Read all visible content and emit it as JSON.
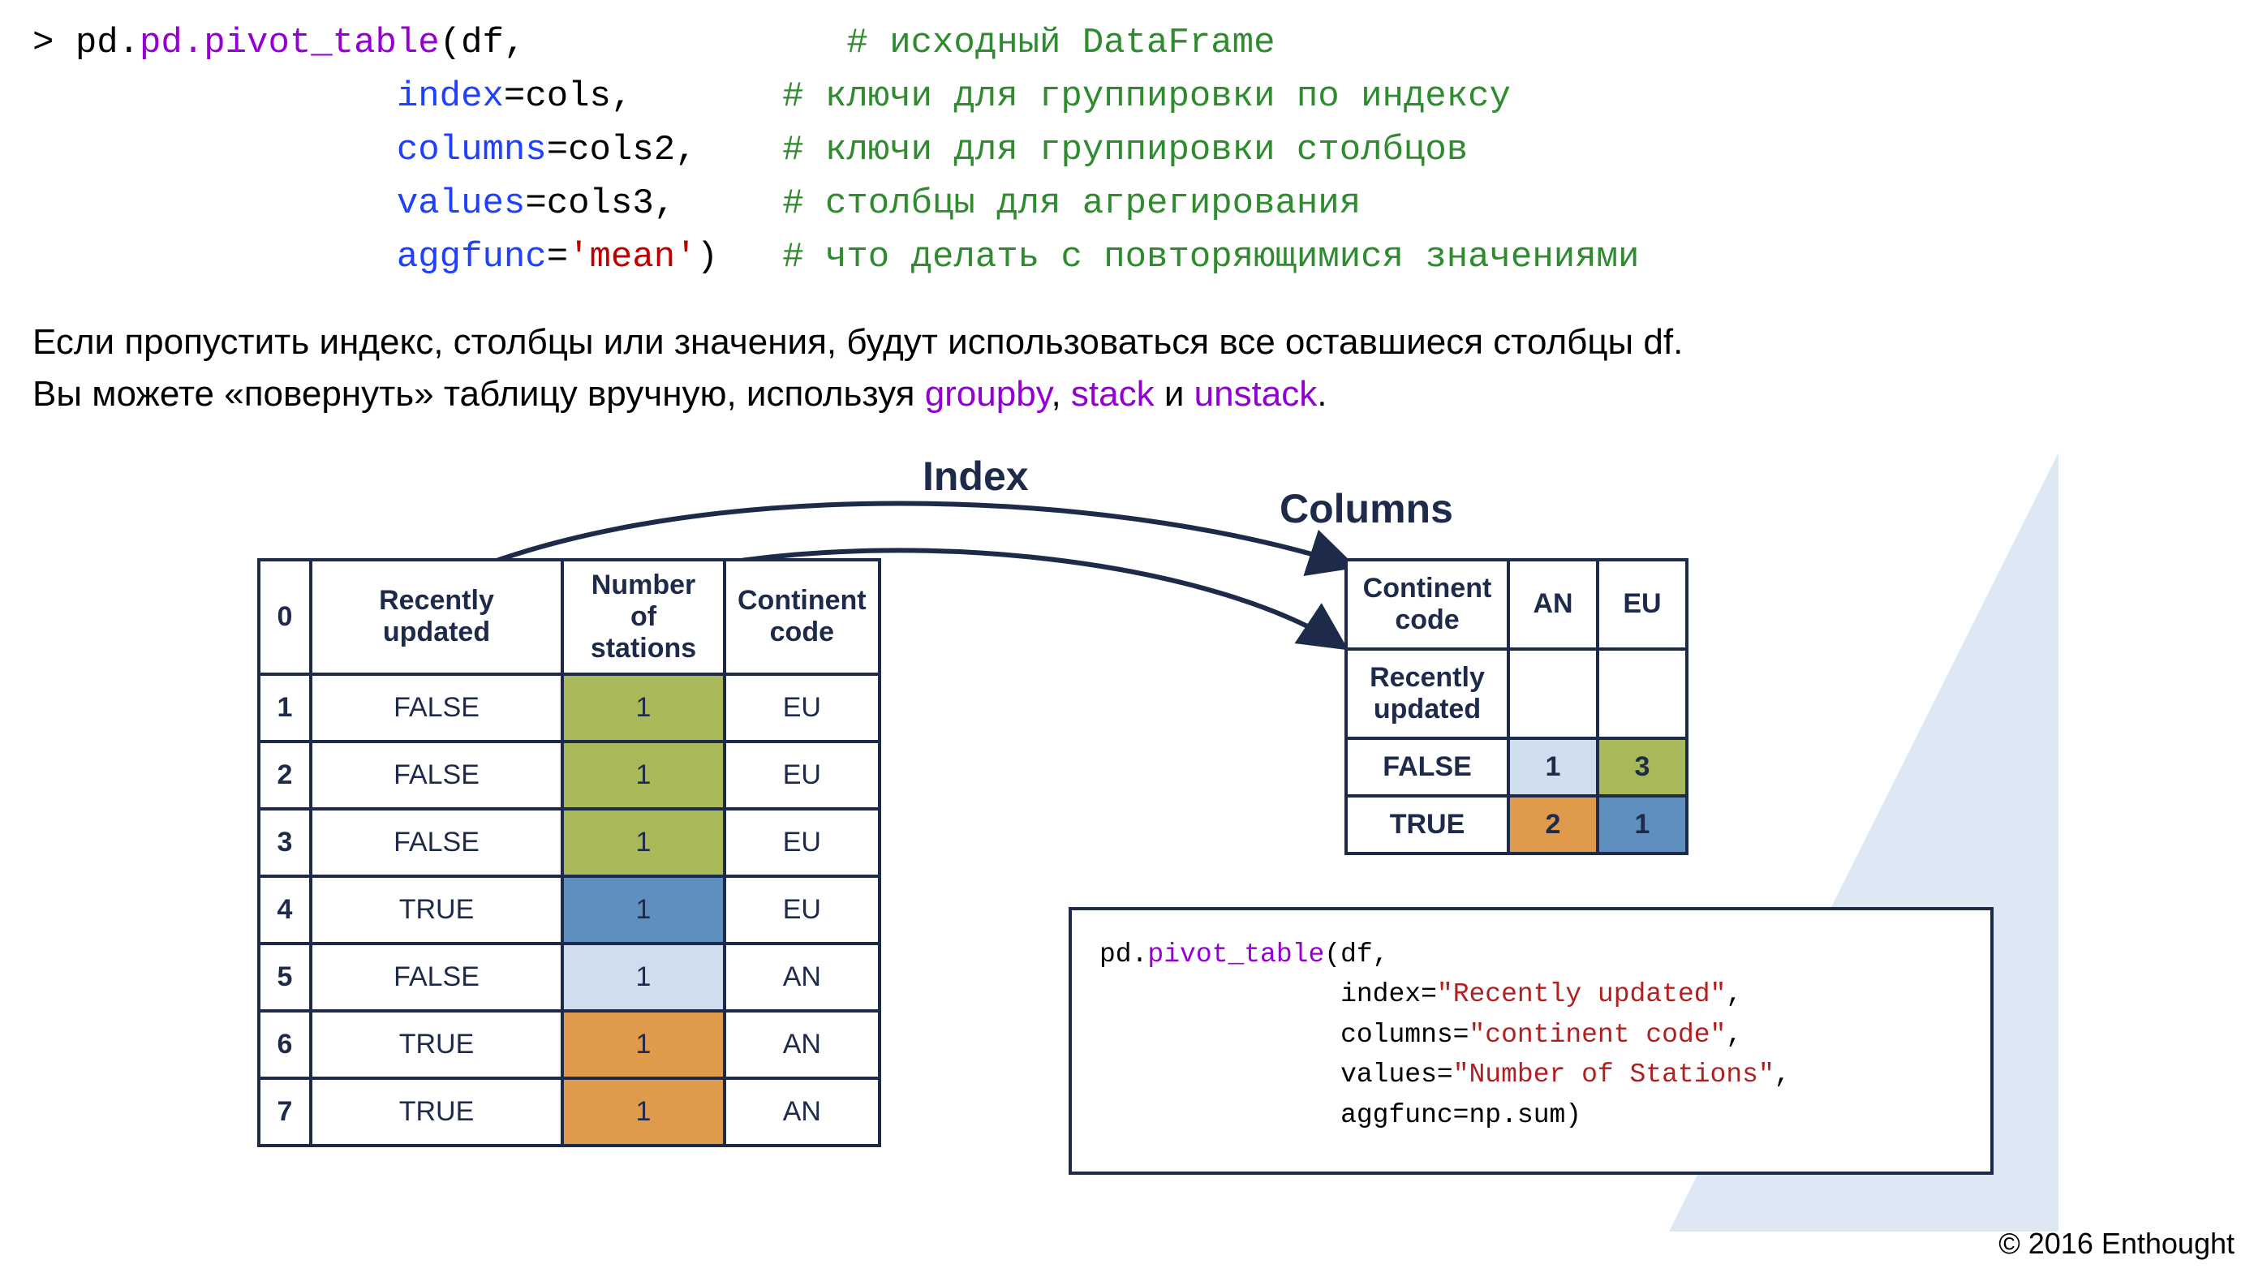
{
  "code": {
    "prompt": "> ",
    "fn": "pd.pivot_table",
    "df": "df",
    "kwIndex": "index",
    "valIndex": "cols",
    "kwColumns": "columns",
    "valColumns": "cols2",
    "kwValues": "values",
    "valValues": "cols3",
    "kwAgg": "aggfunc",
    "valAgg": "'mean'",
    "c1": "# исходный DataFrame",
    "c2": "# ключи для группировки по индексу",
    "c3": "# ключи для группировки столбцов",
    "c4": "# столбцы для агрегирования",
    "c5": "# что делать с повторяющимися значениями"
  },
  "para": {
    "l1": "Если пропустить индекс, столбцы или значения, будут использоваться все оставшиеся столбцы df.",
    "l2a": "Вы можете «повернуть» таблицу вручную, используя ",
    "link1": "groupby",
    "l2b": ", ",
    "link2": "stack",
    "l2c": " и ",
    "link3": "unstack",
    "l2d": "."
  },
  "labels": {
    "index": "Index",
    "columns": "Columns"
  },
  "srcTable": {
    "headers": {
      "idx": "0",
      "ru": "Recently updated",
      "ns": "Number of\nstations",
      "cc": "Continent\ncode"
    },
    "rows": [
      {
        "idx": "1",
        "ru": "FALSE",
        "ns": "1",
        "cc": "EU",
        "nsClass": "c-olive"
      },
      {
        "idx": "2",
        "ru": "FALSE",
        "ns": "1",
        "cc": "EU",
        "nsClass": "c-olive"
      },
      {
        "idx": "3",
        "ru": "FALSE",
        "ns": "1",
        "cc": "EU",
        "nsClass": "c-olive"
      },
      {
        "idx": "4",
        "ru": "TRUE",
        "ns": "1",
        "cc": "EU",
        "nsClass": "c-blue"
      },
      {
        "idx": "5",
        "ru": "FALSE",
        "ns": "1",
        "cc": "AN",
        "nsClass": "c-lblue"
      },
      {
        "idx": "6",
        "ru": "TRUE",
        "ns": "1",
        "cc": "AN",
        "nsClass": "c-orange"
      },
      {
        "idx": "7",
        "ru": "TRUE",
        "ns": "1",
        "cc": "AN",
        "nsClass": "c-orange"
      }
    ]
  },
  "pvtTable": {
    "h1": "Continent\ncode",
    "h2": "AN",
    "h3": "EU",
    "r1": "Recently\nupdated",
    "rows": [
      {
        "label": "FALSE",
        "an": "1",
        "eu": "3",
        "anClass": "c-lblue",
        "euClass": "c-olive"
      },
      {
        "label": "TRUE",
        "an": "2",
        "eu": "1",
        "anClass": "c-orange",
        "euClass": "c-blue"
      }
    ]
  },
  "snippet": {
    "l1a": "pd.",
    "l1b": "pivot_table",
    "l1c": "(df,",
    "l2a": "index=",
    "l2b": "\"Recently updated\"",
    "l2c": ",",
    "l3a": "columns=",
    "l3b": "\"continent code\"",
    "l3c": ",",
    "l4a": "values=",
    "l4b": "\"Number of Stations\"",
    "l4c": ",",
    "l5": "aggfunc=np.sum)"
  },
  "copyright": "© 2016 Enthought"
}
